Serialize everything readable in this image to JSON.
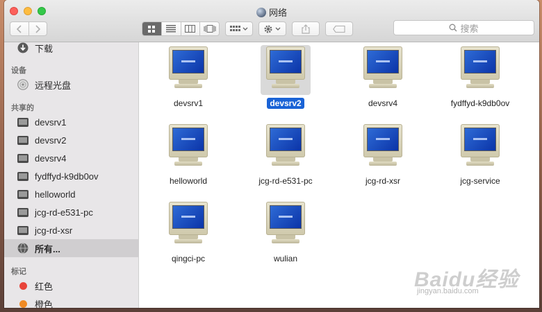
{
  "window": {
    "title": "网络"
  },
  "toolbar": {
    "search_placeholder": "搜索"
  },
  "sidebar": {
    "top_item": {
      "label": "下载",
      "icon": "download-icon"
    },
    "sections": [
      {
        "title": "设备",
        "items": [
          {
            "label": "远程光盘",
            "icon": "disc-icon"
          }
        ]
      },
      {
        "title": "共享的",
        "items": [
          {
            "label": "devsrv1",
            "icon": "monitor-icon"
          },
          {
            "label": "devsrv2",
            "icon": "monitor-icon"
          },
          {
            "label": "devsrv4",
            "icon": "monitor-icon"
          },
          {
            "label": "fydffyd-k9db0ov",
            "icon": "monitor-icon"
          },
          {
            "label": "helloworld",
            "icon": "monitor-icon"
          },
          {
            "label": "jcg-rd-e531-pc",
            "icon": "monitor-icon"
          },
          {
            "label": "jcg-rd-xsr",
            "icon": "monitor-icon"
          },
          {
            "label": "所有...",
            "icon": "globe-icon",
            "selected": true
          }
        ]
      },
      {
        "title": "标记",
        "items": [
          {
            "label": "红色",
            "color": "#e8443a"
          },
          {
            "label": "橙色",
            "color": "#f08a24"
          }
        ]
      }
    ]
  },
  "main": {
    "selected": "devsrv2",
    "items": [
      {
        "label": "devsrv1"
      },
      {
        "label": "devsrv2"
      },
      {
        "label": "devsrv4"
      },
      {
        "label": "fydffyd-k9db0ov"
      },
      {
        "label": "helloworld"
      },
      {
        "label": "jcg-rd-e531-pc"
      },
      {
        "label": "jcg-rd-xsr"
      },
      {
        "label": "jcg-service"
      },
      {
        "label": "qingci-pc"
      },
      {
        "label": "wulian"
      }
    ]
  },
  "watermark": {
    "line1": "Baidu经验",
    "line2": "jingyan.baidu.com"
  }
}
